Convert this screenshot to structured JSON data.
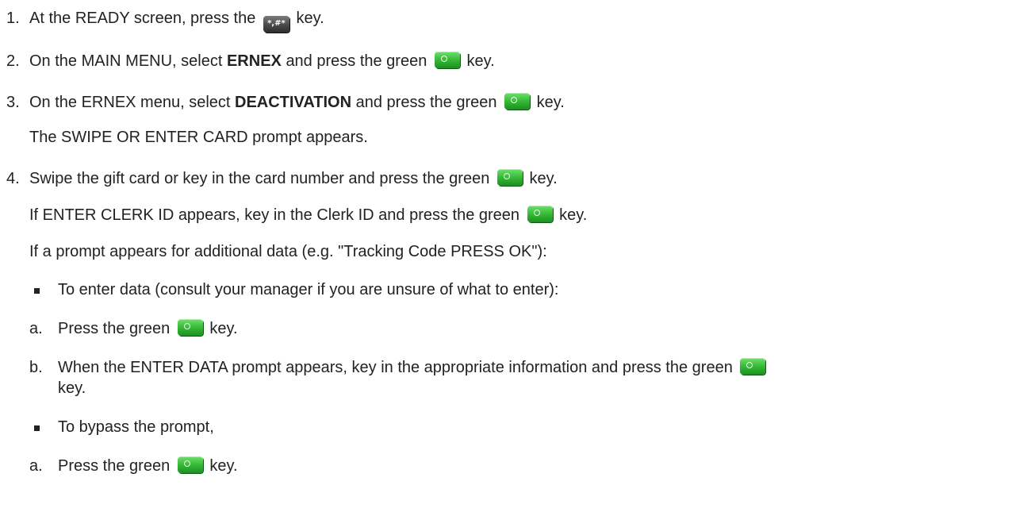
{
  "icons": {
    "green_key": "green-ok-key-icon",
    "star_hash_key": "star-hash-key-icon",
    "bullet": "square-bullet-icon"
  },
  "colors": {
    "green_key": "#33b533",
    "dark_key": "#4a4a4a",
    "text": "#222222"
  },
  "step1": {
    "number": "1.",
    "before": "At the READY screen, press the",
    "key_label": "*,#*",
    "after": "key."
  },
  "step2": {
    "number": "2.",
    "before": "On the MAIN MENU, select",
    "bold": "ERNEX",
    "middle": "and press the green",
    "after": "key."
  },
  "step3": {
    "number": "3.",
    "before": "On the ERNEX menu, select",
    "bold": "DEACTIVATION",
    "middle": "and press the green",
    "after": "key.",
    "note": "The SWIPE OR ENTER CARD prompt appears."
  },
  "step4": {
    "number": "4.",
    "before": "Swipe the gift card or key in the card number and press the green",
    "after": "key.",
    "clerk_before": "If ENTER CLERK ID appears, key in the Clerk ID and press the green",
    "clerk_after": "key.",
    "additional": "If a prompt appears for additional data (e.g. \"Tracking Code PRESS OK\"):"
  },
  "enter_data": {
    "bullet_text": "To enter data (consult your manager if you are unsure of what to enter):",
    "a_letter": "a.",
    "a_before": "Press the green",
    "a_after": "key.",
    "b_letter": "b.",
    "b_before": "When the ENTER DATA prompt appears, key in the appropriate information and press the green",
    "b_after": "key."
  },
  "bypass": {
    "bullet_text": "To bypass the prompt,",
    "a_letter": "a.",
    "a_before": "Press the green",
    "a_after": "key."
  }
}
